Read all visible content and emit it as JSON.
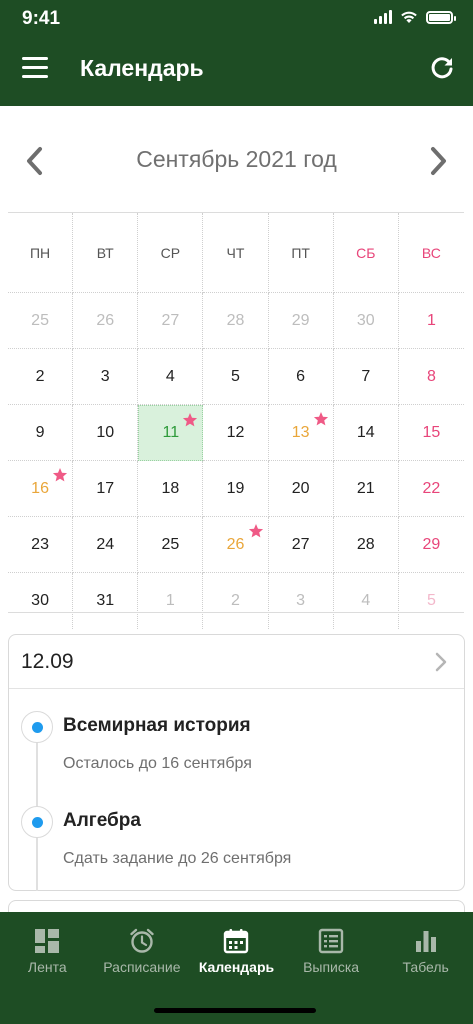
{
  "status_bar": {
    "time": "9:41"
  },
  "header": {
    "title": "Календарь",
    "menu_icon": "menu-icon",
    "refresh_icon": "refresh-icon"
  },
  "month_nav": {
    "title": "Сентябрь 2021 год",
    "prev_icon": "chevron-left-icon",
    "next_icon": "chevron-right-icon"
  },
  "colors": {
    "primary": "#1e4d24",
    "weekend": "#e8457a",
    "event": "#e9a63a",
    "today": "#2e9b3a",
    "today_bg": "#d9f1dc",
    "star": "#ef5a86",
    "dot": "#1f9bee"
  },
  "calendar": {
    "weekdays": [
      {
        "label": "ПН",
        "weekend": false
      },
      {
        "label": "ВТ",
        "weekend": false
      },
      {
        "label": "СР",
        "weekend": false
      },
      {
        "label": "ЧТ",
        "weekend": false
      },
      {
        "label": "ПТ",
        "weekend": false
      },
      {
        "label": "СБ",
        "weekend": true
      },
      {
        "label": "ВС",
        "weekend": true
      }
    ],
    "days": [
      {
        "d": "25",
        "outside": true
      },
      {
        "d": "26",
        "outside": true
      },
      {
        "d": "27",
        "outside": true
      },
      {
        "d": "28",
        "outside": true
      },
      {
        "d": "29",
        "outside": true
      },
      {
        "d": "30",
        "outside": true
      },
      {
        "d": "1",
        "weekend": true
      },
      {
        "d": "2"
      },
      {
        "d": "3"
      },
      {
        "d": "4"
      },
      {
        "d": "5"
      },
      {
        "d": "6"
      },
      {
        "d": "7"
      },
      {
        "d": "8",
        "weekend": true
      },
      {
        "d": "9"
      },
      {
        "d": "10"
      },
      {
        "d": "11",
        "today": true,
        "star": true
      },
      {
        "d": "12"
      },
      {
        "d": "13",
        "event": true,
        "star": true
      },
      {
        "d": "14"
      },
      {
        "d": "15",
        "weekend": true
      },
      {
        "d": "16",
        "event": true,
        "star": true
      },
      {
        "d": "17"
      },
      {
        "d": "18"
      },
      {
        "d": "19"
      },
      {
        "d": "20"
      },
      {
        "d": "21"
      },
      {
        "d": "22",
        "weekend": true
      },
      {
        "d": "23"
      },
      {
        "d": "24"
      },
      {
        "d": "25"
      },
      {
        "d": "26",
        "event": true,
        "star": true
      },
      {
        "d": "27"
      },
      {
        "d": "28"
      },
      {
        "d": "29",
        "weekend": true
      },
      {
        "d": "30"
      },
      {
        "d": "31"
      },
      {
        "d": "1",
        "outside": true
      },
      {
        "d": "2",
        "outside": true
      },
      {
        "d": "3",
        "outside": true
      },
      {
        "d": "4",
        "outside": true
      },
      {
        "d": "5",
        "outside": true,
        "weekend": true
      }
    ]
  },
  "event_card": {
    "date": "12.09",
    "items": [
      {
        "title": "Всемирная история",
        "subtitle": "Осталось до 16 сентября"
      },
      {
        "title": "Алгебра",
        "subtitle": "Сдать задание до 26 сентября"
      }
    ]
  },
  "bottom_nav": {
    "items": [
      {
        "label": "Лента",
        "icon": "feed-icon",
        "active": false
      },
      {
        "label": "Расписание",
        "icon": "alarm-clock-icon",
        "active": false
      },
      {
        "label": "Календарь",
        "icon": "calendar-icon",
        "active": true
      },
      {
        "label": "Выписка",
        "icon": "list-icon",
        "active": false
      },
      {
        "label": "Табель",
        "icon": "bar-chart-icon",
        "active": false
      }
    ]
  }
}
